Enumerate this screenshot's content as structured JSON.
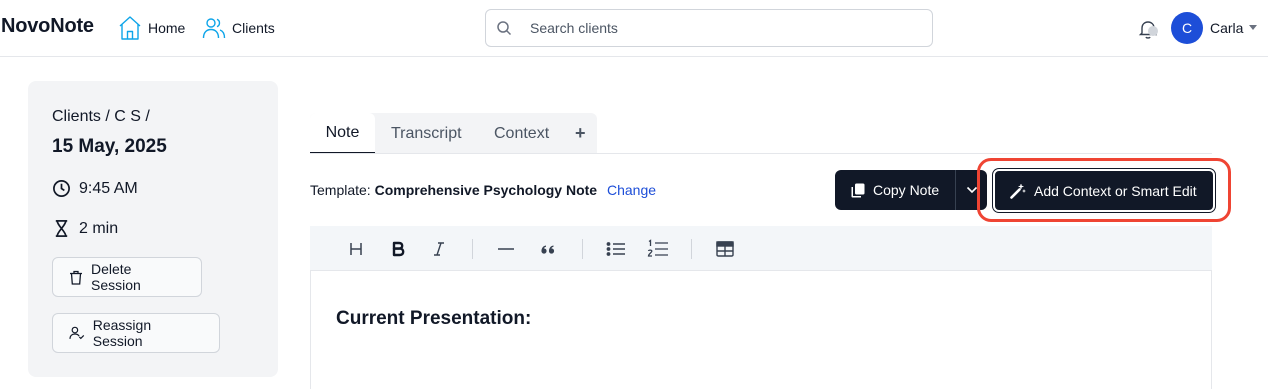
{
  "app": {
    "name": "NovoNote"
  },
  "nav": {
    "home_label": "Home",
    "clients_label": "Clients"
  },
  "search": {
    "placeholder": "Search clients",
    "value": ""
  },
  "user": {
    "avatar_initial": "C",
    "name": "Carla",
    "avatar_color": "#1d4ed8"
  },
  "session": {
    "breadcrumb": "Clients / C S /",
    "date": "15 May, 2025",
    "time": "9:45 AM",
    "duration": "2 min",
    "delete_label": "Delete Session",
    "reassign_label": "Reassign Session"
  },
  "tabs": {
    "items": [
      "Note",
      "Transcript",
      "Context"
    ],
    "add_label": "+",
    "active": "Note"
  },
  "template": {
    "prefix": "Template:",
    "name": "Comprehensive Psychology Note",
    "change_label": "Change"
  },
  "actions": {
    "copy_label": "Copy Note",
    "smart_edit_label": "Add Context or Smart Edit",
    "highlight_color": "#ef4433"
  },
  "toolbar": {
    "icons": [
      "heading-icon",
      "bold-icon",
      "italic-icon",
      "horizontal-rule-icon",
      "quote-icon",
      "bullet-list-icon",
      "numbered-list-icon",
      "table-icon"
    ]
  },
  "editor": {
    "heading": "Current Presentation:"
  }
}
